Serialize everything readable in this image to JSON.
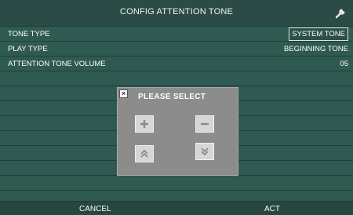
{
  "header": {
    "title": "CONFIG ATTENTION TONE",
    "icon": "wrench-icon"
  },
  "settings": [
    {
      "label": "TONE TYPE",
      "value": "SYSTEM TONE"
    },
    {
      "label": "PLAY TYPE",
      "value": "BEGINNING TONE"
    },
    {
      "label": "ATTENTION TONE VOLUME",
      "value": "05"
    }
  ],
  "popup": {
    "title": "PLEASE SELECT",
    "close_icon": "close-icon",
    "buttons": [
      "plus-icon",
      "minus-icon",
      "double-chevron-up-icon",
      "double-chevron-down-icon"
    ]
  },
  "footer": {
    "cancel_label": "CANCEL",
    "act_label": "ACT"
  },
  "colors": {
    "background": "#2f4f49",
    "row": "#2f5a52",
    "popup": "#8c8c8c",
    "popup_button": "#d6d6d6"
  }
}
